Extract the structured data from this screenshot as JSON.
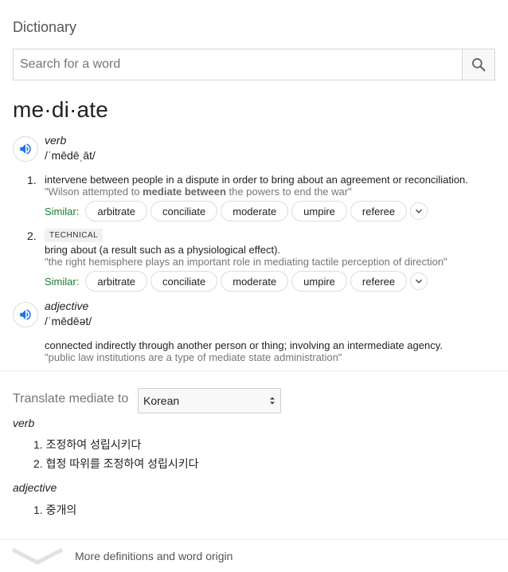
{
  "header": {
    "title": "Dictionary"
  },
  "search": {
    "placeholder": "Search for a word",
    "value": ""
  },
  "entry": {
    "headword": "me·di·ate",
    "verb": {
      "pos": "verb",
      "phonetic": "/ˈmēdēˌāt/",
      "senses": [
        {
          "number": "1.",
          "definition": "intervene between people in a dispute in order to bring about an agreement or reconciliation.",
          "example_pre": "\"Wilson attempted to ",
          "example_bold": "mediate between",
          "example_post": " the powers to end the war\"",
          "similar_label": "Similar:",
          "similar": [
            "arbitrate",
            "conciliate",
            "moderate",
            "umpire",
            "referee"
          ]
        },
        {
          "number": "2.",
          "tag": "TECHNICAL",
          "definition": "bring about (a result such as a physiological effect).",
          "example": "\"the right hemisphere plays an important role in mediating tactile perception of direction\"",
          "similar_label": "Similar:",
          "similar": [
            "arbitrate",
            "conciliate",
            "moderate",
            "umpire",
            "referee"
          ]
        }
      ]
    },
    "adjective": {
      "pos": "adjective",
      "phonetic": "/ˈmēdēət/",
      "definition": "connected indirectly through another person or thing; involving an intermediate agency.",
      "example": "\"public law institutions are a type of mediate state administration\""
    }
  },
  "translate": {
    "label": "Translate mediate to",
    "language": "Korean",
    "verb_label": "verb",
    "verb_items": [
      "조정하여 성립시키다",
      "협정 따위를 조정하여 성립시키다"
    ],
    "adjective_label": "adjective",
    "adjective_items": [
      "중개의"
    ]
  },
  "footer": {
    "more_label": "More definitions and word origin"
  },
  "colors": {
    "similar": "#1a7d2c",
    "speaker": "#1a73e8"
  },
  "icons": {
    "search": "search-icon",
    "speaker": "speaker-icon",
    "expand": "chevron-down-icon",
    "more": "chevron-down-icon"
  }
}
